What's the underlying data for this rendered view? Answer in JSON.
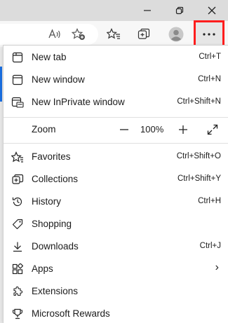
{
  "window": {
    "minimize_icon": "minimize-icon",
    "restore_icon": "restore-icon",
    "close_icon": "close-icon"
  },
  "toolbar": {
    "icons": [
      "read-aloud-icon",
      "add-favorite-icon",
      "favorites-icon",
      "collections-icon",
      "profile-avatar-icon",
      "more-icon"
    ],
    "more_highlight_color": "#ff1e1e"
  },
  "menu": {
    "new_tab": {
      "label": "New tab",
      "shortcut": "Ctrl+T"
    },
    "new_window": {
      "label": "New window",
      "shortcut": "Ctrl+N"
    },
    "new_inprivate": {
      "label": "New InPrivate window",
      "shortcut": "Ctrl+Shift+N"
    },
    "zoom": {
      "label": "Zoom",
      "minus": "—",
      "value": "100%",
      "plus": "+"
    },
    "favorites": {
      "label": "Favorites",
      "shortcut": "Ctrl+Shift+O"
    },
    "collections": {
      "label": "Collections",
      "shortcut": "Ctrl+Shift+Y"
    },
    "history": {
      "label": "History",
      "shortcut": "Ctrl+H"
    },
    "shopping": {
      "label": "Shopping"
    },
    "downloads": {
      "label": "Downloads",
      "shortcut": "Ctrl+J"
    },
    "apps": {
      "label": "Apps",
      "submenu": "›"
    },
    "extensions": {
      "label": "Extensions"
    },
    "rewards": {
      "label": "Microsoft Rewards"
    }
  }
}
